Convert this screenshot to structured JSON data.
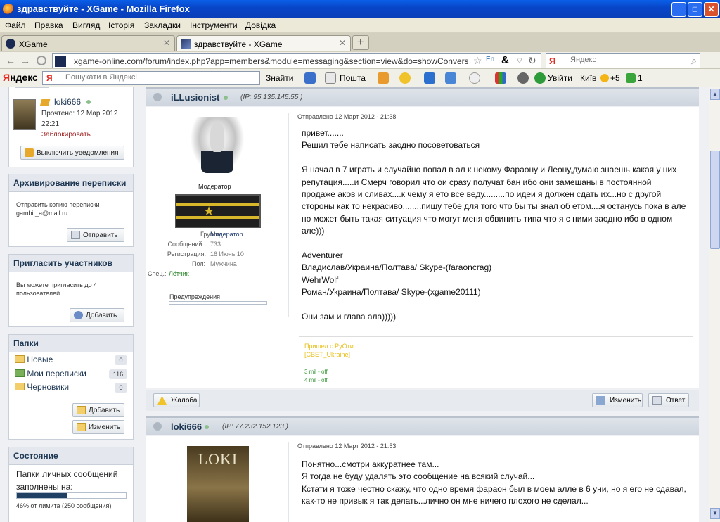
{
  "window": {
    "title": "здравствуйте - XGame - Mozilla Firefox",
    "btn_min": "_",
    "btn_max": "□",
    "btn_close": "✕"
  },
  "menu": [
    "Файл",
    "Правка",
    "Вигляд",
    "Історія",
    "Закладки",
    "Інструменти",
    "Довідка"
  ],
  "tabs": [
    {
      "label": "XGame",
      "close": "✕",
      "active": false
    },
    {
      "label": "здравствуйте - XGame",
      "close": "✕",
      "active": true
    }
  ],
  "newtab": "+",
  "nav": {
    "back": "←",
    "forward": "→",
    "url": "xgame-online.com/forum/index.php?app=members&module=messaging&section=view&do=showConversation&topic",
    "search_placeholder": "Яндекс",
    "search_engine": "Я"
  },
  "yabar": {
    "logo_first": "Я",
    "logo_rest": "ндекс",
    "input_placeholder": "Пошукати в Яндексі",
    "find": "Знайти",
    "mail": "Пошта",
    "login": "Увійти",
    "city": "Київ",
    "weather": "+5",
    "count": "1"
  },
  "sidebar": {
    "user": {
      "name": "loki666",
      "read": "Прочтено: 12 Мар 2012",
      "time": "22:21",
      "block": "Заблокировать",
      "notify_btn": "Выключить уведомления"
    },
    "archive": {
      "title": "Архивирование переписки",
      "text1": "Отправить копию переписки",
      "text2": "gambit_a@mail.ru",
      "btn": "Отправить"
    },
    "invite": {
      "title": "Пригласить участников",
      "text1": "Вы можете пригласить до 4",
      "text2": "пользователей",
      "btn": "Добавить"
    },
    "folders": {
      "title": "Папки",
      "items": [
        {
          "label": "Новые",
          "count": "0"
        },
        {
          "label": "Мои переписки",
          "count": "116"
        },
        {
          "label": "Черновики",
          "count": "0"
        }
      ],
      "add_btn": "Добавить",
      "edit_btn": "Изменить"
    },
    "status": {
      "title": "Состояние",
      "text1": "Папки личных сообщений",
      "text2": "заполнены на:",
      "percent": 46,
      "limit": "46% от лимита (250 сообщения)"
    }
  },
  "post1": {
    "author": "iLLusionist",
    "ip": "(IP: 95.135.145.55 )",
    "role": "Модератор",
    "group_label": "Группа:",
    "group": "Модератор",
    "posts_label": "Сообщений:",
    "posts": "733",
    "reg_label": "Регистрация:",
    "reg": "16 Июнь 10",
    "sex_label": "Пол:",
    "sex": "Мужчина",
    "spec_label": "Спец.:",
    "spec": "Лётчик",
    "warn": "Предупреждения",
    "date": "Отправлено 12 Март 2012 - 21:38",
    "lines": [
      "привет.......",
      "Решил тебе написать заодно посоветоваться",
      "",
      "Я начал в 7 играть и случайно попал в ал к некому Фараону и Леону,думаю знаешь какая у них",
      "репутация.....и Смерч говорил что ои сразу получат бан ибо они замешаны в постоянной",
      "продаже аков и сливах....к чему я ето все веду.........по идеи я должен сдать их...но с другой",
      "стороны как то некрасиво........пишу тебе для того что бы ты знал об етом....я останусь пока в але",
      "но может быть такая ситуация что могут меня обвинить типа что я с ними заодно ибо в одном",
      "але)))",
      "",
      "Adventurer",
      "Владислав/Украина/Полтава/ Skype-(faraoncrag)",
      "WehrWolf",
      "Роман/Украина/Полтава/ Skype-(xgame20111)",
      "",
      "Они зам и глава ала)))))"
    ],
    "sig1": "Пришел с РуОти",
    "sig2": "[СВЕТ_Ukraine]",
    "sig3": "3 mil - off",
    "sig4": "4 mil - off",
    "report_btn": "Жалоба",
    "edit_btn": "Изменить",
    "reply_btn": "Ответ"
  },
  "post2": {
    "author": "loki666",
    "ip": "(IP: 77.232.152.123 )",
    "avatar_text": "LOKI",
    "date": "Отправлено 12 Март 2012 - 21:53",
    "lines": [
      "Понятно...смотри аккуратнее там...",
      "Я тогда не буду удалять это сообщение на всякий случай...",
      "Кстати я тоже честно скажу, что одно время фараон был в моем алле в 6 уни, но я его не сдавал,",
      "как-то не привык я так делать...лично он мне ничего плохого не сделал..."
    ]
  }
}
